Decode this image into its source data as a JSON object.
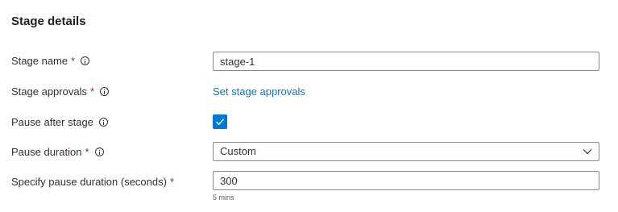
{
  "section": {
    "title": "Stage details"
  },
  "fields": {
    "stage_name": {
      "label": "Stage name",
      "required": "*",
      "value": "stage-1"
    },
    "stage_approvals": {
      "label": "Stage approvals",
      "required": "*",
      "link": "Set stage approvals"
    },
    "pause_after_stage": {
      "label": "Pause after stage",
      "checked": true
    },
    "pause_duration": {
      "label": "Pause duration",
      "required": "*",
      "selected": "Custom"
    },
    "pause_seconds": {
      "label": "Specify pause duration (seconds)",
      "required": "*",
      "value": "300",
      "hint": "5 mins"
    }
  },
  "icons": {
    "info": "info-icon",
    "check": "checkmark-icon",
    "dropdown": "chevron-down-icon"
  },
  "colors": {
    "accent": "#0078d4",
    "required": "#a4262c",
    "border": "#8a8886",
    "text": "#323130"
  }
}
